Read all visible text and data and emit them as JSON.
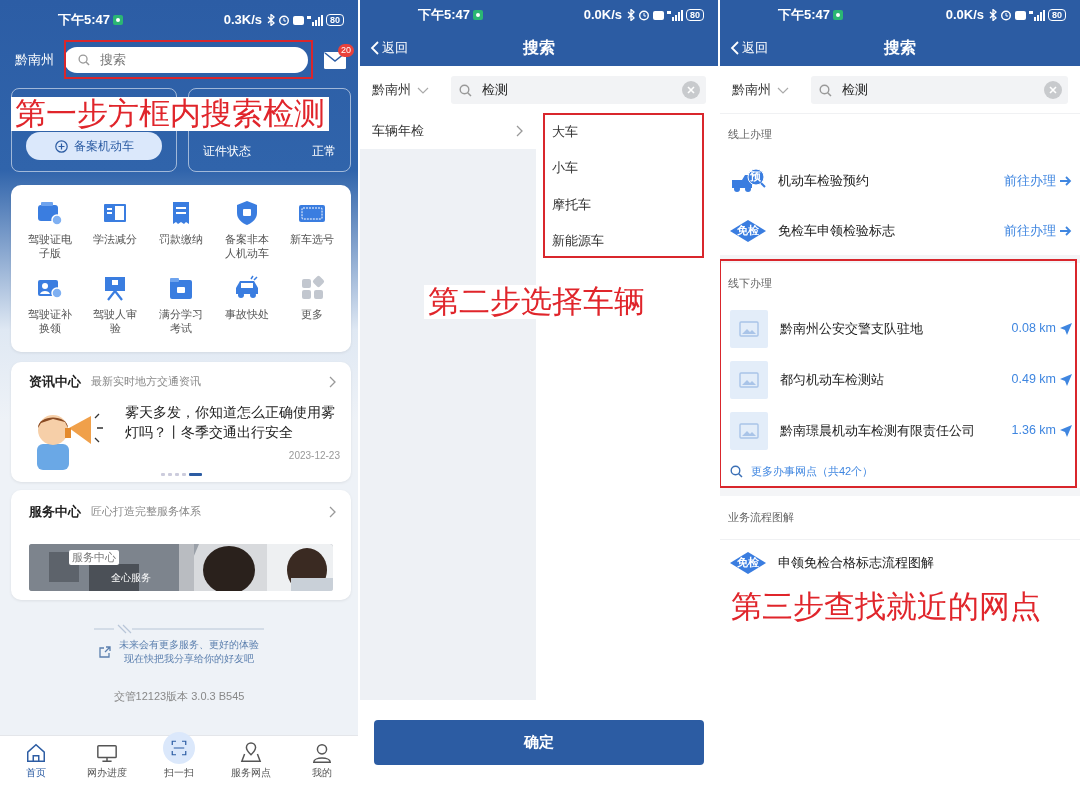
{
  "home_screen": {
    "status_bar": {
      "time": "下午5:47",
      "speed": "0.3K/s",
      "battery": "80"
    },
    "region": "黔南州",
    "search": {
      "placeholder": "搜索"
    },
    "mail_badge": "20",
    "vehicle_card": {
      "button": "备案机动车"
    },
    "license_card": {
      "label": "证件状态",
      "value": "正常"
    },
    "services": [
      {
        "label": "驾驶证电子版"
      },
      {
        "label": "学法减分"
      },
      {
        "label": "罚款缴纳"
      },
      {
        "label": "备案非本人机动车"
      },
      {
        "label": "新车选号"
      },
      {
        "label": "驾驶证补换领"
      },
      {
        "label": "驾驶人审验"
      },
      {
        "label": "满分学习考试"
      },
      {
        "label": "事故快处"
      },
      {
        "label": "更多"
      }
    ],
    "news": {
      "title": "资讯中心",
      "subtitle": "最新实时地方交通资讯",
      "headline": "雾天多发，你知道怎么正确使用雾灯吗？丨冬季交通出行安全",
      "date": "2023-12-23",
      "pages": [
        {
          "selected": false
        },
        {
          "selected": false
        },
        {
          "selected": false
        },
        {
          "selected": false
        },
        {
          "selected": true
        }
      ]
    },
    "service_center": {
      "title": "服务中心",
      "subtitle": "匠心打造完整服务体系",
      "banner_tag": "服务中心",
      "banner_text": "全心服务"
    },
    "share_lines": [
      "未来会有更多服务、更好的体验",
      "现在快把我分享给你的好友吧"
    ],
    "version": "交管12123版本 3.0.3 B545",
    "tabs": [
      {
        "label": "首页",
        "selected": true
      },
      {
        "label": "网办进度",
        "selected": false
      },
      {
        "label": "扫一扫",
        "selected": false
      },
      {
        "label": "服务网点",
        "selected": false
      },
      {
        "label": "我的",
        "selected": false
      }
    ]
  },
  "search_screen": {
    "status_bar": {
      "time": "下午5:47",
      "speed": "0.0K/s",
      "battery": "80"
    },
    "back": "返回",
    "title": "搜索",
    "region": "黔南州",
    "query": "检测",
    "categories": [
      {
        "label": "车辆年检",
        "selected": true
      }
    ],
    "options": [
      {
        "label": "大车"
      },
      {
        "label": "小车"
      },
      {
        "label": "摩托车"
      },
      {
        "label": "新能源车"
      }
    ],
    "confirm": "确定"
  },
  "results_screen": {
    "status_bar": {
      "time": "下午5:47",
      "speed": "0.0K/s",
      "battery": "80"
    },
    "back": "返回",
    "title": "搜索",
    "region": "黔南州",
    "query": "检测",
    "online": {
      "title": "线上办理",
      "items": [
        {
          "name": "机动车检验预约",
          "badge": "预",
          "action": "前往办理"
        },
        {
          "name": "免检车申领检验标志",
          "badge": "免检",
          "action": "前往办理"
        }
      ]
    },
    "offline": {
      "title": "线下办理",
      "stations": [
        {
          "name": "黔南州公安交警支队驻地",
          "distance": "0.08 km"
        },
        {
          "name": "都匀机动车检测站",
          "distance": "0.49 km"
        },
        {
          "name": "黔南璟晨机动车检测有限责任公司",
          "distance": "1.36 km"
        }
      ],
      "more": "更多办事网点（共42个）"
    },
    "guides": {
      "title": "业务流程图解",
      "items": [
        {
          "name": "申领免检合格标志流程图解",
          "badge": "免检"
        }
      ]
    }
  },
  "annotations": [
    {
      "text": "第一步方框内搜索检测"
    },
    {
      "text": "第二步选择车辆"
    },
    {
      "text": "第三步查找就近的网点"
    }
  ]
}
